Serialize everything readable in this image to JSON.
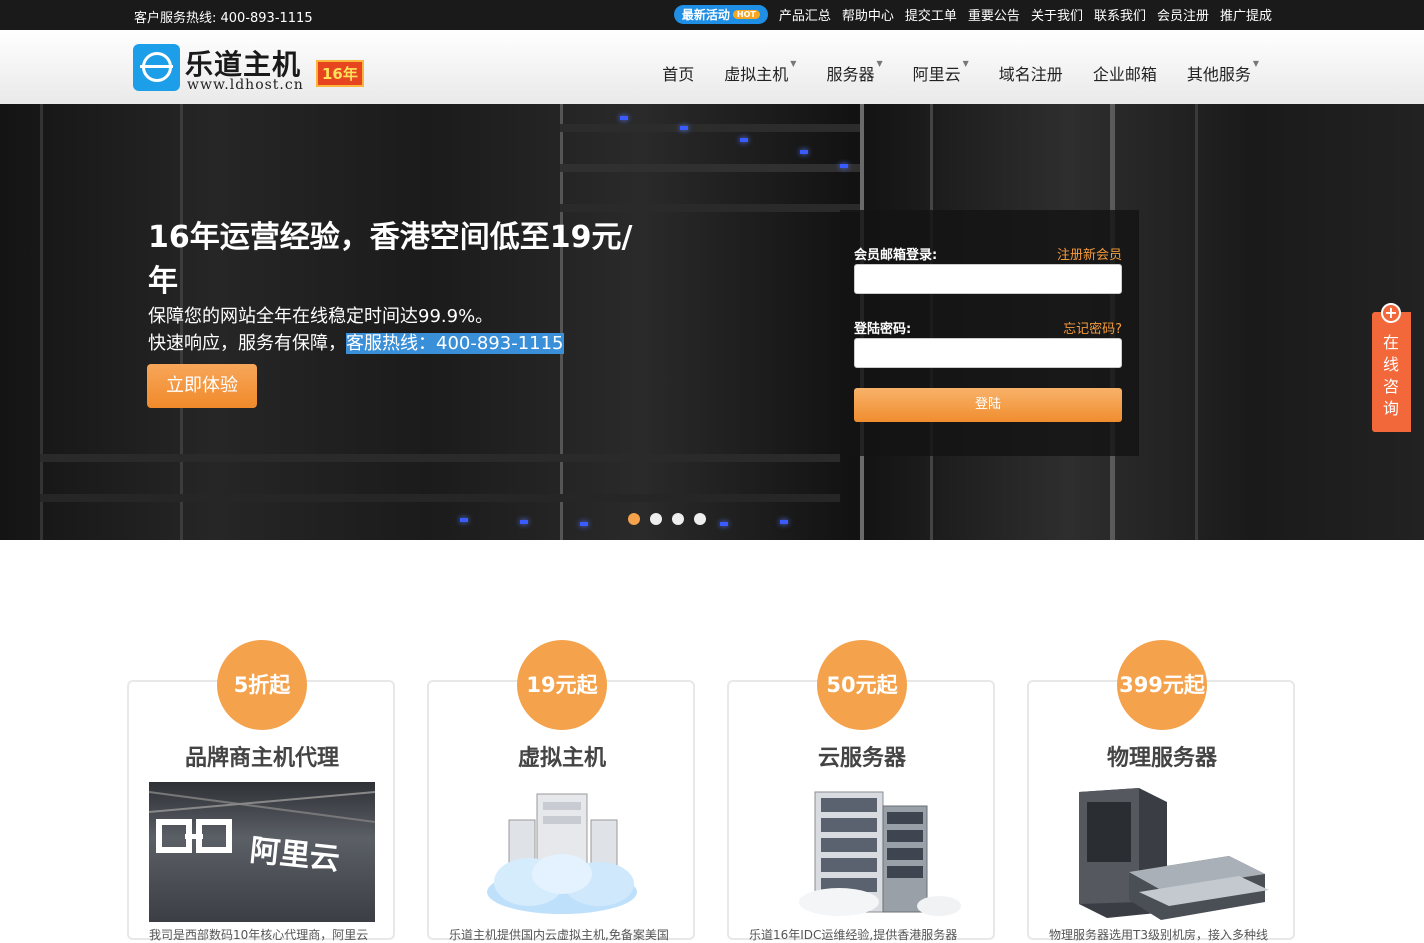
{
  "topbar": {
    "hotline_label": "客户服务热线: 400-893-1115",
    "promo_label": "最新活动",
    "promo_badge": "HOT",
    "links": [
      "产品汇总",
      "帮助中心",
      "提交工单",
      "重要公告",
      "关于我们",
      "联系我们",
      "会员注册",
      "推广提成"
    ]
  },
  "header": {
    "logo_name": "乐道主机",
    "logo_url": "www.ldhost.cn",
    "logo_badge": "16年",
    "nav": [
      {
        "label": "首页",
        "dropdown": false
      },
      {
        "label": "虚拟主机",
        "dropdown": true
      },
      {
        "label": "服务器",
        "dropdown": true
      },
      {
        "label": "阿里云",
        "dropdown": true
      },
      {
        "label": "域名注册",
        "dropdown": false
      },
      {
        "label": "企业邮箱",
        "dropdown": false
      },
      {
        "label": "其他服务",
        "dropdown": true
      }
    ]
  },
  "hero": {
    "title": "16年运营经验，香港空间低至19元/年",
    "sub1": "保障您的网站全年在线稳定时间达99.9%。",
    "sub2_prefix": "快速响应，服务有保障，",
    "sub2_highlight": "客服热线：400-893-1115",
    "cta_label": "立即体验",
    "slides": 4,
    "active_slide": 1
  },
  "login": {
    "email_label": "会员邮箱登录:",
    "register_link": "注册新会员",
    "password_label": "登陆密码:",
    "forgot_link": "忘记密码?",
    "email_value": "",
    "password_value": "",
    "submit_label": "登陆"
  },
  "chat": {
    "icon": "plus-icon",
    "label": "在线咨询"
  },
  "cards": [
    {
      "price": "5折起",
      "title": "品牌商主机代理",
      "desc": "我司是西部数码10年核心代理商，阿里云"
    },
    {
      "price": "19元起",
      "title": "虚拟主机",
      "desc": "乐道主机提供国内云虚拟主机,免备案美国"
    },
    {
      "price": "50元起",
      "title": "云服务器",
      "desc": "乐道16年IDC运维经验,提供香港服务器"
    },
    {
      "price": "399元起",
      "title": "物理服务器",
      "desc": "物理服务器选用T3级别机房，接入多种线"
    }
  ],
  "colors": {
    "accent": "#f4a24c",
    "topbar": "#1a1a1a",
    "brand_blue": "#1d9ee8",
    "chat": "#f2683a"
  }
}
